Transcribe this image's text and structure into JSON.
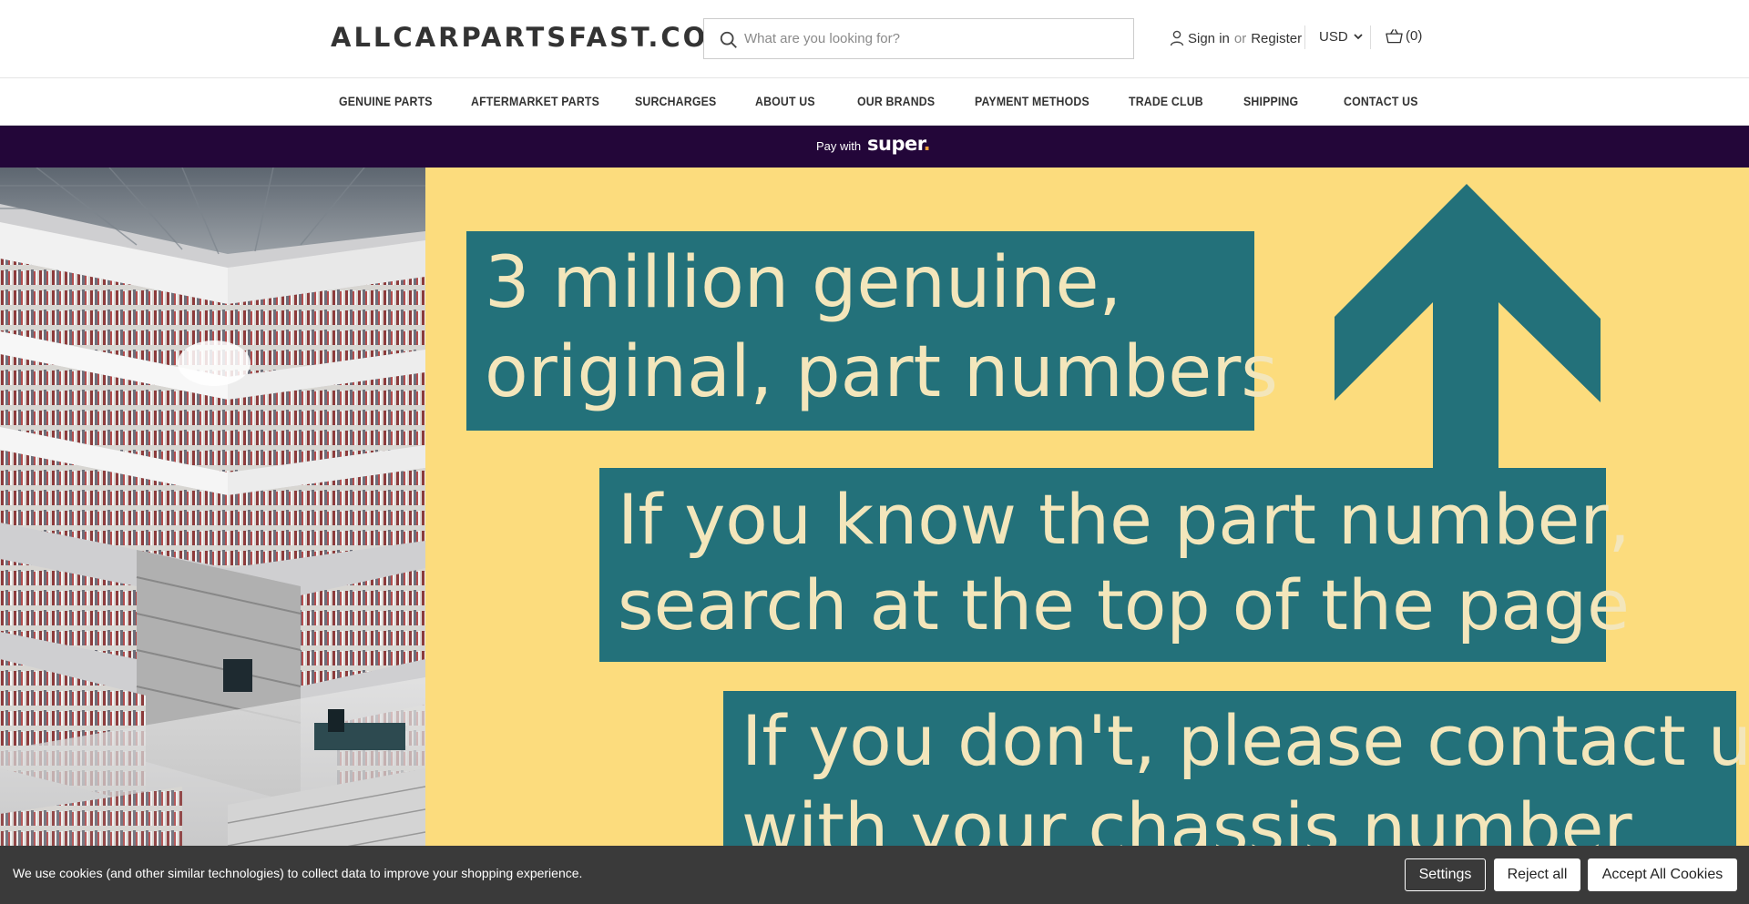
{
  "header": {
    "logo": "ALLCARPARTSFAST.CO.UK",
    "search_placeholder": "What are you looking for?",
    "sign_in": "Sign in",
    "or": "or",
    "register": "Register",
    "currency": "USD",
    "cart": "(0)"
  },
  "nav": {
    "items": [
      {
        "label": "GENUINE PARTS"
      },
      {
        "label": "AFTERMARKET PARTS"
      },
      {
        "label": "SURCHARGES"
      },
      {
        "label": "ABOUT US"
      },
      {
        "label": "OUR BRANDS"
      },
      {
        "label": "PAYMENT METHODS"
      },
      {
        "label": "TRADE CLUB"
      },
      {
        "label": "SHIPPING"
      },
      {
        "label": "CONTACT US"
      }
    ]
  },
  "superbar": {
    "pay_with": "Pay with",
    "brand": "super",
    "brand_dot": ".",
    "colors": {
      "background": "#230639",
      "dot": "#f2a23c"
    }
  },
  "hero": {
    "line1a": "3 million genuine,",
    "line1b": "original, part numbers",
    "line2a": "If you know the part number,",
    "line2b": "search at the top of the page",
    "line3a": "If you don't, please contact us",
    "line3b": "with your chassis number",
    "colors": {
      "banner": "#fcdc7d",
      "box": "#23717a",
      "text": "#f3e6bb"
    }
  },
  "cookie": {
    "message": "We use cookies (and other similar technologies) to collect data to improve your shopping experience.",
    "settings": "Settings",
    "reject": "Reject all",
    "accept": "Accept All Cookies"
  }
}
